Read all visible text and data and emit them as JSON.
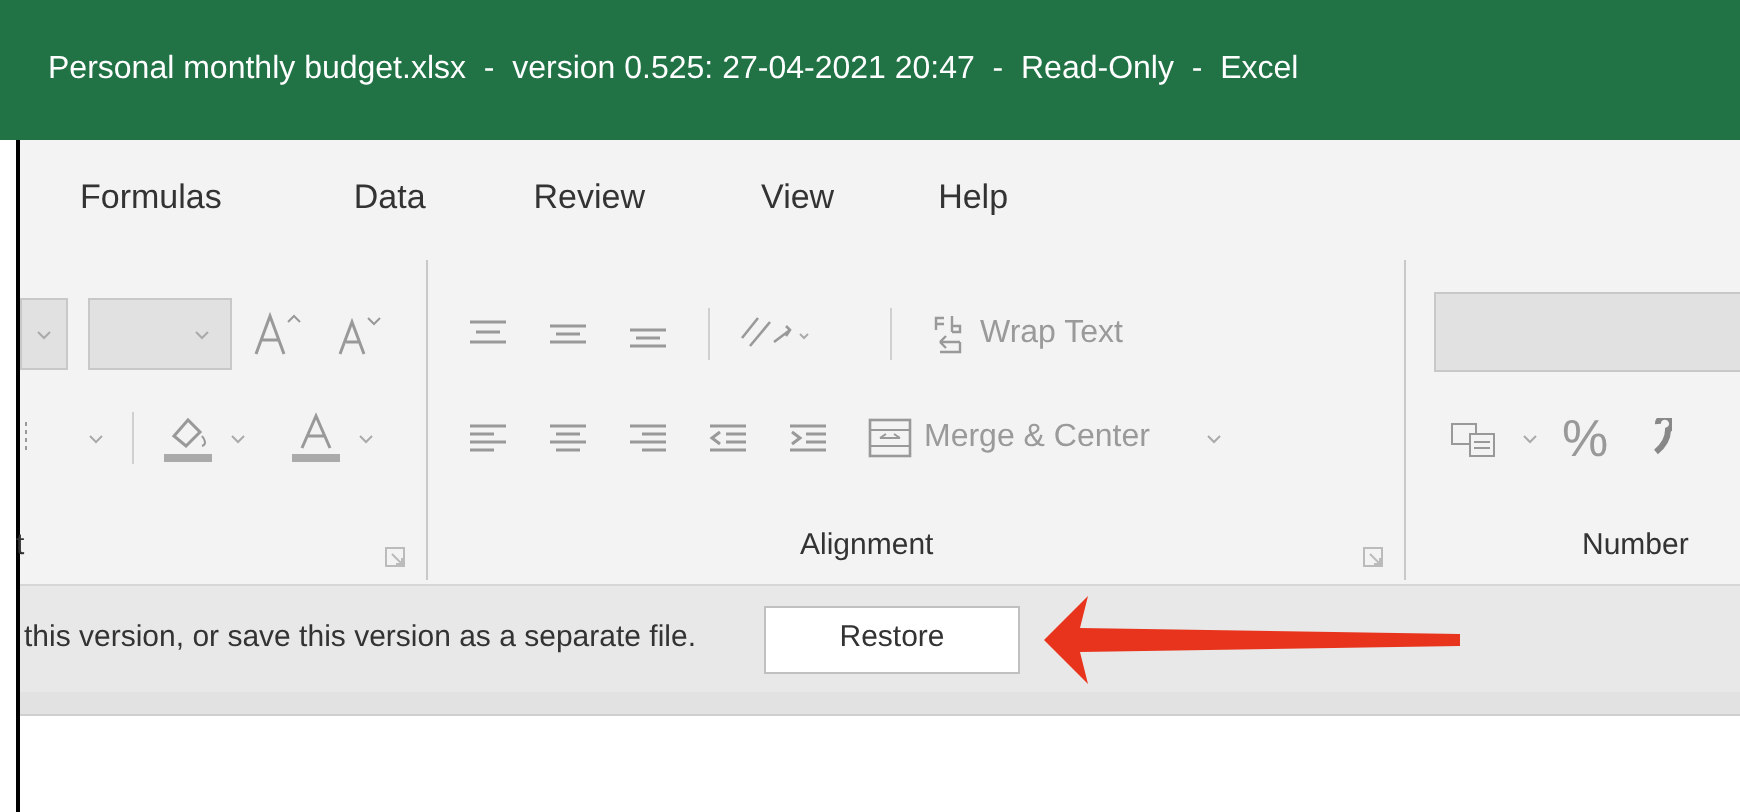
{
  "window": {
    "title": "Personal monthly budget.xlsx  -  version 0.525: 27-04-2021 20:47  -  Read-Only  -  Excel"
  },
  "tabs": [
    {
      "label": "Formulas"
    },
    {
      "label": "Data"
    },
    {
      "label": "Review"
    },
    {
      "label": "View"
    },
    {
      "label": "Help"
    }
  ],
  "ribbon": {
    "groups": [
      {
        "label": "t"
      },
      {
        "label": "Alignment"
      },
      {
        "label": "Number"
      }
    ],
    "wrap_text": "Wrap Text",
    "merge_center": "Merge & Center",
    "percent": "%"
  },
  "message_bar": {
    "text": "this version, or save this version as a separate file.",
    "button": "Restore"
  }
}
